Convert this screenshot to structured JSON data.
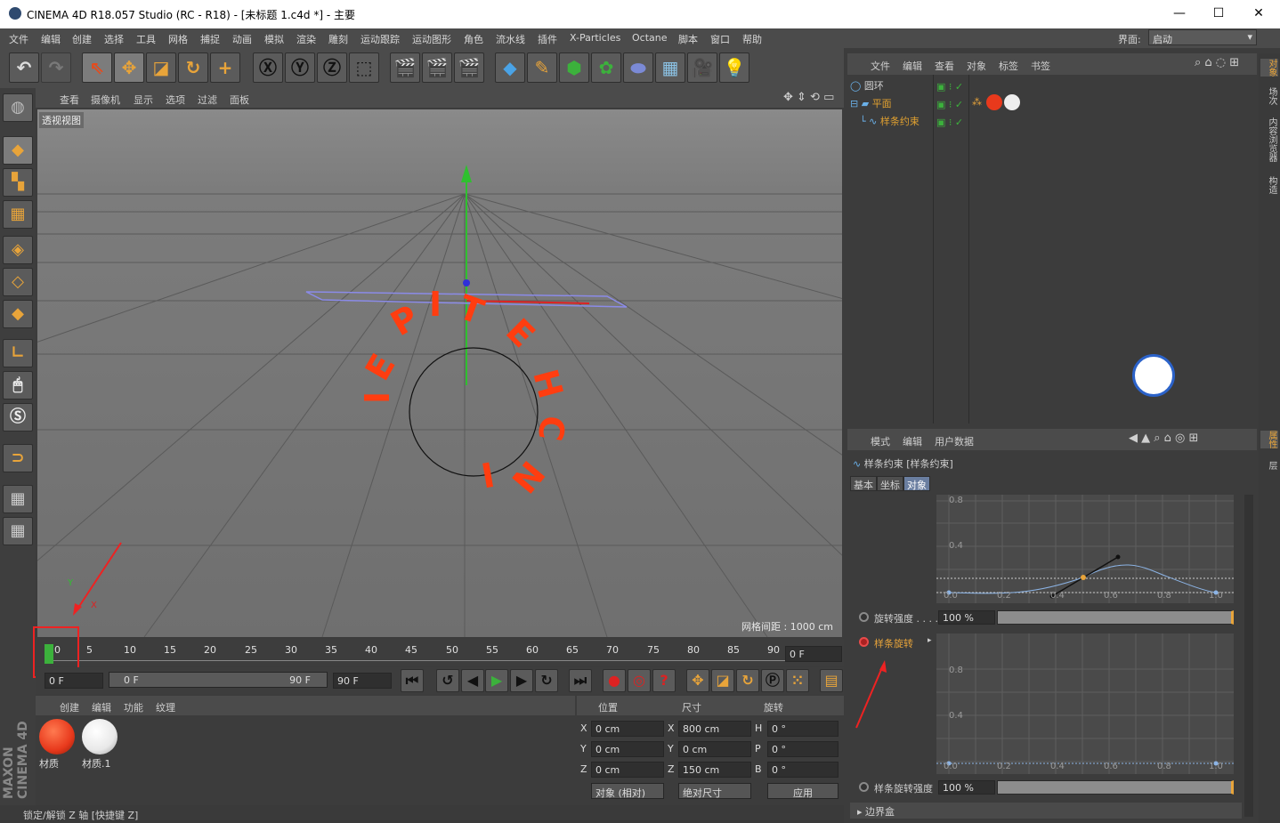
{
  "titlebar": {
    "title": "CINEMA 4D R18.057 Studio (RC - R18) - [未标题 1.c4d *] - 主要",
    "minimize": "—",
    "maximize": "☐",
    "close": "✕"
  },
  "menu": [
    "文件",
    "编辑",
    "创建",
    "选择",
    "工具",
    "网格",
    "捕捉",
    "动画",
    "模拟",
    "渲染",
    "雕刻",
    "运动跟踪",
    "运动图形",
    "角色",
    "流水线",
    "插件",
    "X-Particles",
    "Octane",
    "脚本",
    "窗口",
    "帮助"
  ],
  "layout": {
    "label": "界面:",
    "value": "启动"
  },
  "viewport": {
    "menu": [
      "查看",
      "摄像机",
      "显示",
      "选项",
      "过滤",
      "面板"
    ],
    "label": "透视视图",
    "grid_info": "网格间距 : 1000 cm",
    "axis_y": "Y",
    "axis_x": "X"
  },
  "timeline": {
    "ticks": [
      "0",
      "5",
      "10",
      "15",
      "20",
      "25",
      "30",
      "35",
      "40",
      "45",
      "50",
      "55",
      "60",
      "65",
      "70",
      "75",
      "80",
      "85",
      "90"
    ],
    "end_field": "0 F"
  },
  "controls": {
    "cur_frame": "0 F",
    "range_start": "0 F",
    "range_end": "90 F",
    "max_frame": "90 F"
  },
  "materials": {
    "menu": [
      "创建",
      "编辑",
      "功能",
      "纹理"
    ],
    "items": [
      {
        "name": "材质",
        "color": "#e8391c"
      },
      {
        "name": "材质.1",
        "color": "#ffffff"
      }
    ]
  },
  "coords": {
    "headers": [
      "位置",
      "尺寸",
      "旋转"
    ],
    "rows": [
      {
        "a": "X",
        "pos": "0 cm",
        "b": "X",
        "size": "800 cm",
        "c": "H",
        "rot": "0 °"
      },
      {
        "a": "Y",
        "pos": "0 cm",
        "b": "Y",
        "size": "0 cm",
        "c": "P",
        "rot": "0 °"
      },
      {
        "a": "Z",
        "pos": "0 cm",
        "b": "Z",
        "size": "150 cm",
        "c": "B",
        "rot": "0 °"
      }
    ],
    "mode": "对象 (相对)",
    "size_mode": "绝对尺寸",
    "apply": "应用"
  },
  "status": "锁定/解锁 Z 轴 [快捷键 Z]",
  "maxon": "MAXON CINEMA 4D",
  "objects": {
    "menu": [
      "文件",
      "编辑",
      "查看",
      "对象",
      "标签",
      "书签"
    ],
    "items": [
      "圆环",
      "平面",
      "样条约束"
    ]
  },
  "sidetabs": [
    "对象",
    "场次",
    "内容浏览器",
    "构造",
    "属性",
    "层"
  ],
  "attributes": {
    "menu": [
      "模式",
      "编辑",
      "用户数据"
    ],
    "title": "样条约束 [样条约束]",
    "tabs": [
      "基本",
      "坐标",
      "对象"
    ],
    "graph_labels_y": [
      "0.8",
      "0.4"
    ],
    "graph_labels_x": [
      "0.0",
      "0.2",
      "0.4",
      "0.6",
      "0.8",
      "1.0"
    ],
    "rot_strength": {
      "label": "旋转强度 . . . .",
      "value": "100 %"
    },
    "spline_rot": "样条旋转",
    "spline_rot_strength": {
      "label": "样条旋转强度",
      "value": "100 %"
    },
    "bbox": "边界盒"
  },
  "accent": "#e8a43a"
}
